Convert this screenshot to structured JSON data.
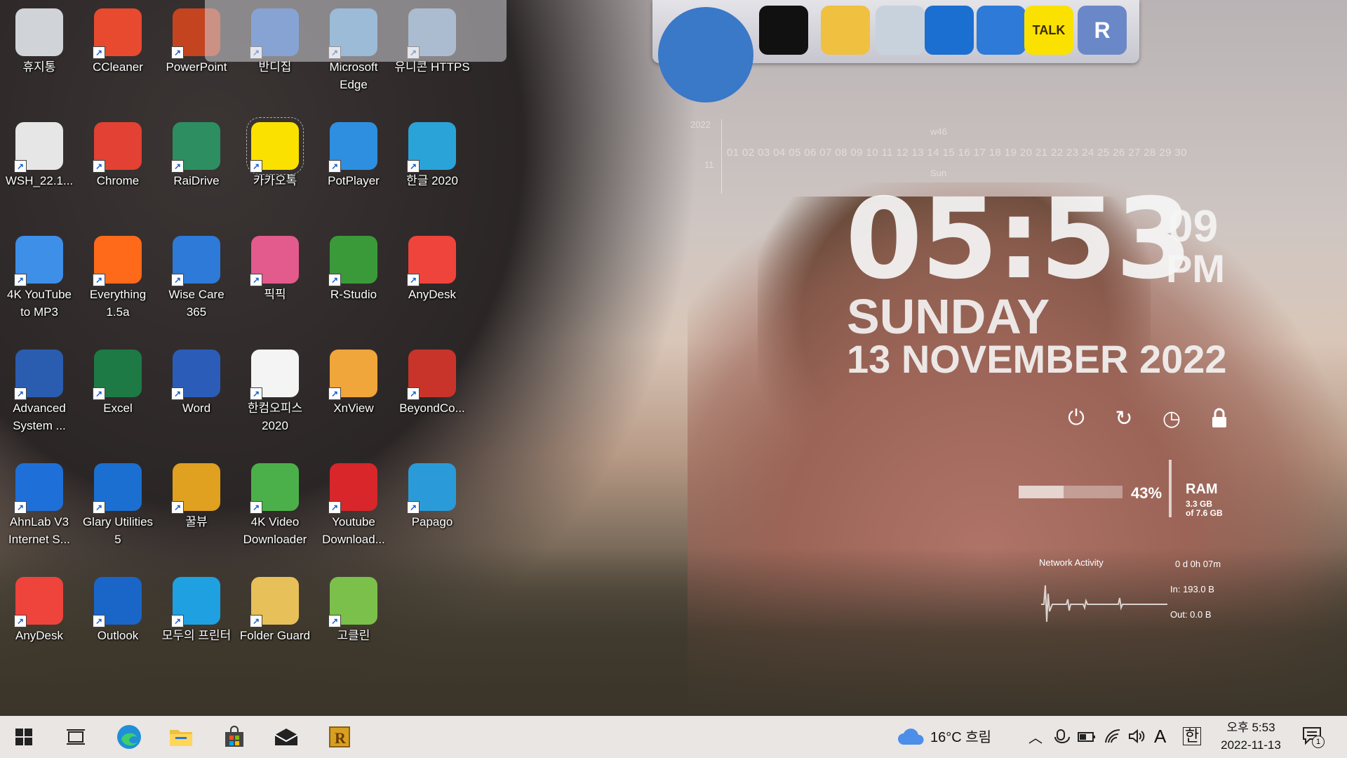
{
  "desktop_icons": [
    {
      "label": "휴지통",
      "icon": "recycle-bin-icon",
      "color": "#d0d4d8"
    },
    {
      "label": "CCleaner",
      "icon": "ccleaner-icon",
      "color": "#e84a2f"
    },
    {
      "label": "PowerPoint",
      "icon": "powerpoint-icon",
      "color": "#c4441f"
    },
    {
      "label": "반디집",
      "icon": "bandizip-icon",
      "color": "#2d6ad0"
    },
    {
      "label": "Microsoft Edge",
      "icon": "edge-folder-icon",
      "color": "#5aa0d8"
    },
    {
      "label": "유니콘 HTTPS",
      "icon": "unicorn-https-icon",
      "color": "#7fa3c8"
    },
    {
      "label": "WSH_22.1...",
      "icon": "disc-file-icon",
      "color": "#e6e6e6"
    },
    {
      "label": "Chrome",
      "icon": "chrome-icon",
      "color": "#e34133"
    },
    {
      "label": "RaiDrive",
      "icon": "raidrive-icon",
      "color": "#2d8e62"
    },
    {
      "label": "카카오톡",
      "icon": "kakaotalk-icon",
      "color": "#fae100"
    },
    {
      "label": "PotPlayer",
      "icon": "potplayer-icon",
      "color": "#2e8fe0"
    },
    {
      "label": "한글 2020",
      "icon": "hangul-icon",
      "color": "#2aa3d8"
    },
    {
      "label": "4K YouTube to MP3",
      "icon": "youtube-mp3-icon",
      "color": "#3d8fe8"
    },
    {
      "label": "Everything 1.5a",
      "icon": "everything-search-icon",
      "color": "#ff6a1a"
    },
    {
      "label": "Wise Care 365",
      "icon": "wise-care-icon",
      "color": "#2d7ad8"
    },
    {
      "label": "픽픽",
      "icon": "picpick-icon",
      "color": "#e35a8c"
    },
    {
      "label": "R-Studio",
      "icon": "r-studio-icon",
      "color": "#3a9a3a"
    },
    {
      "label": "AnyDesk",
      "icon": "anydesk-icon",
      "color": "#ef443b"
    },
    {
      "label": "Advanced System ...",
      "icon": "advanced-systemcare-icon",
      "color": "#2a5db0"
    },
    {
      "label": "Excel",
      "icon": "excel-icon",
      "color": "#1d7a45"
    },
    {
      "label": "Word",
      "icon": "word-icon",
      "color": "#2b5cb8"
    },
    {
      "label": "한컴오피스 2020",
      "icon": "hancom-office-icon",
      "color": "#f4f4f4"
    },
    {
      "label": "XnView",
      "icon": "xnview-icon",
      "color": "#f0a63a"
    },
    {
      "label": "BeyondCo...",
      "icon": "beyond-compare-icon",
      "color": "#c8342a"
    },
    {
      "label": "AhnLab V3 Internet S...",
      "icon": "ahnlab-v3-icon",
      "color": "#1e70d8"
    },
    {
      "label": "Glary Utilities 5",
      "icon": "glary-utilities-icon",
      "color": "#1b6fd0"
    },
    {
      "label": "꿀뷰",
      "icon": "honeyview-icon",
      "color": "#e0a020"
    },
    {
      "label": "4K Video Downloader",
      "icon": "video-downloader-icon",
      "color": "#4cb04a"
    },
    {
      "label": "Youtube Download...",
      "icon": "youtube-downloader-icon",
      "color": "#d8262a"
    },
    {
      "label": "Papago",
      "icon": "papago-icon",
      "color": "#2a9bd8"
    },
    {
      "label": "AnyDesk",
      "icon": "anydesk-icon",
      "color": "#ef443b"
    },
    {
      "label": "Outlook",
      "icon": "outlook-icon",
      "color": "#1a66c8"
    },
    {
      "label": "모두의 프린터",
      "icon": "printer-icon",
      "color": "#1fa0e0"
    },
    {
      "label": "Folder Guard",
      "icon": "folder-guard-icon",
      "color": "#e8c05a"
    },
    {
      "label": "고클린",
      "icon": "goclean-icon",
      "color": "#7bc04a"
    }
  ],
  "dock_items": [
    {
      "icon": "globe-icon",
      "color": "#3a78c8"
    },
    {
      "icon": "tshirt-icon",
      "color": "#111111"
    },
    {
      "icon": "hammer-wrench-icon",
      "color": "#f0c040"
    },
    {
      "icon": "recycle-bin-icon",
      "color": "#c8d2dc"
    },
    {
      "icon": "glary-moon-icon",
      "color": "#1b6fd0"
    },
    {
      "icon": "wise-shield-icon",
      "color": "#2d7ad8"
    },
    {
      "icon": "kakaotalk-icon",
      "color": "#fae100",
      "text": "TALK"
    },
    {
      "icon": "registry-icon",
      "color": "#6a88c8",
      "text": "R"
    }
  ],
  "clock": {
    "time": "05:53",
    "seconds": "09",
    "ampm": "PM",
    "day": "SUNDAY",
    "date": "13 NOVEMBER  2022"
  },
  "calendar": {
    "year": "2022",
    "month": "11",
    "week": "w46",
    "weekday": "Sun",
    "days": "01 02 03 04 05 06 07 08 09 10 11 12 13 14 15 16 17 18 19 20 21 22 23 24 25 26 27 28 29 30"
  },
  "system": {
    "ram_percent": "43%",
    "ram_fill": 0.43,
    "ram_label": "RAM",
    "ram_used": "3.3 GB",
    "ram_total": "of 7.6 GB",
    "net_title": "Network Activity",
    "uptime": "0 d 0h 07m",
    "net_in": "In: 193.0 B",
    "net_out": "Out: 0.0 B"
  },
  "taskbar": {
    "weather": "16°C  흐림",
    "ime_mode": "A",
    "ime_lang": "한",
    "clock_time": "오후 5:53",
    "clock_date": "2022-11-13",
    "notification_count": "1"
  }
}
